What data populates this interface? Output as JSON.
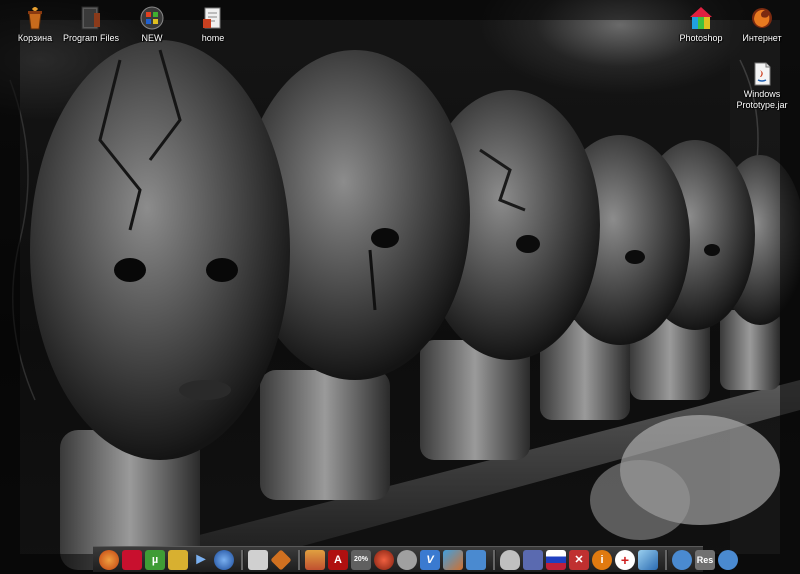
{
  "desktop": {
    "icons": [
      {
        "label": "Корзина"
      },
      {
        "label": "Program Files"
      },
      {
        "label": "NEW"
      },
      {
        "label": "home"
      },
      {
        "label": "Photoshop"
      },
      {
        "label": "Интернет"
      },
      {
        "label": "Windows\nPrototype.jar"
      }
    ]
  },
  "taskbar": {
    "quick_launch": [
      {
        "icon": "firefox-icon",
        "color": "#e86a1a"
      },
      {
        "icon": "red-app-icon",
        "color": "#c8102e"
      },
      {
        "icon": "utorrent-icon",
        "color": "#3f9c35"
      },
      {
        "icon": "tools-icon",
        "color": "#d8b030"
      },
      {
        "icon": "arrow-app-icon",
        "color": "#5a8fd0"
      },
      {
        "icon": "globe-icon",
        "color": "#3a6fc0"
      },
      {
        "icon": "notepad-icon",
        "color": "#9a9a9a"
      },
      {
        "icon": "diamond-app-icon",
        "color": "#d07020"
      },
      {
        "icon": "image-viewer-icon",
        "color": "#c05030"
      },
      {
        "icon": "acrobat-icon",
        "color": "#b01010"
      },
      {
        "icon": "nero-icon",
        "color": "#8a8a8a"
      },
      {
        "icon": "media-player-icon",
        "color": "#c0402a"
      },
      {
        "icon": "skype-icon",
        "color": "#a0a0a0"
      },
      {
        "icon": "v-app-icon",
        "color": "#3a7ad0"
      },
      {
        "icon": "paint-icon",
        "color": "#d07030"
      },
      {
        "icon": "monitor-icon",
        "color": "#4a8ad0"
      },
      {
        "icon": "lightbulb-icon",
        "color": "#c0c0c0"
      },
      {
        "icon": "floppy-icon",
        "color": "#5a6ab0"
      },
      {
        "icon": "flag-icon",
        "color": "#c0203a"
      },
      {
        "icon": "close-app-icon",
        "color": "#c03030"
      },
      {
        "icon": "info-icon",
        "color": "#e07a10"
      },
      {
        "icon": "plus-app-icon",
        "color": "#d02020"
      },
      {
        "icon": "cube-icon",
        "color": "#5a9ad0"
      },
      {
        "icon": "users-icon",
        "color": "#4a8ad0"
      },
      {
        "icon": "res-icon",
        "color": "#707070"
      },
      {
        "icon": "network-icon",
        "color": "#4a8ad0"
      }
    ],
    "res_label": "Res",
    "acrobat_badge": "A",
    "percent_badge": "20%",
    "v_badge": "V",
    "info_badge": "i",
    "plus_badge": "+"
  }
}
